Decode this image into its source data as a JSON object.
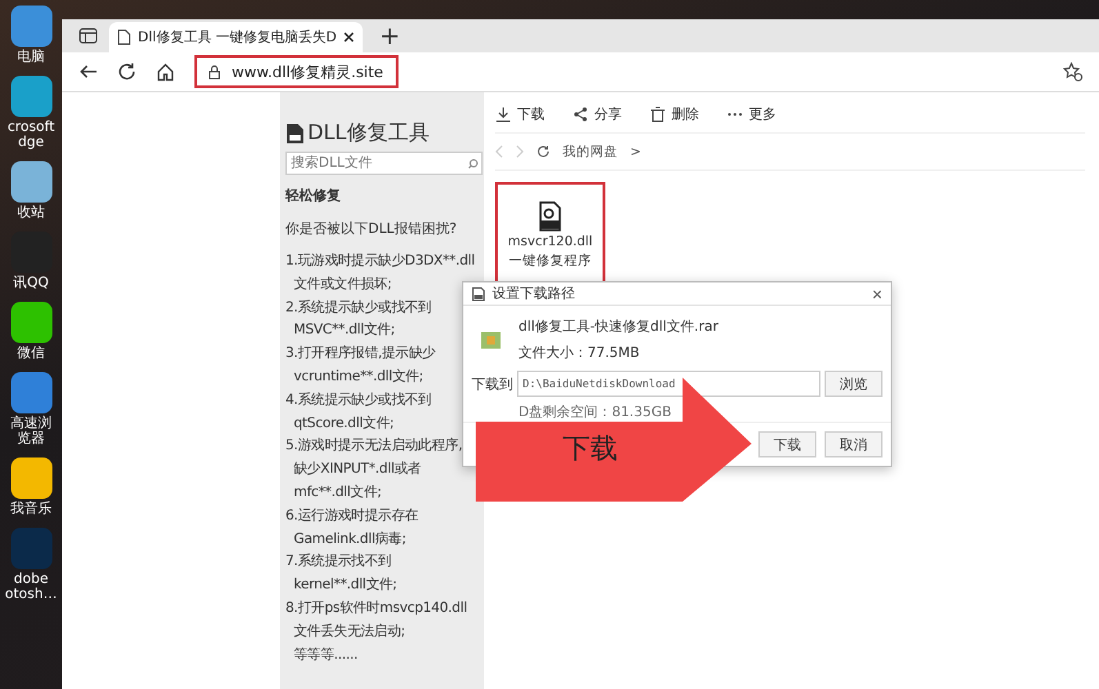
{
  "desktop_icons": [
    {
      "kind": "pc",
      "lines": [
        "电脑"
      ]
    },
    {
      "kind": "edge",
      "lines": [
        "crosoft",
        "dge"
      ]
    },
    {
      "kind": "bin",
      "lines": [
        "收站"
      ]
    },
    {
      "kind": "qq",
      "lines": [
        "讯QQ"
      ]
    },
    {
      "kind": "wechat",
      "lines": [
        "微信"
      ]
    },
    {
      "kind": "browser",
      "lines": [
        "高速浏",
        "览器"
      ]
    },
    {
      "kind": "music",
      "lines": [
        "我音乐"
      ]
    },
    {
      "kind": "ps",
      "lines": [
        "dobe",
        "otosh…"
      ]
    }
  ],
  "browser": {
    "tab": {
      "title": "Dll修复工具 一键修复电脑丢失D",
      "selected": true
    },
    "new_tab": "+",
    "address": "www.dll修复精灵.site"
  },
  "sidebar": {
    "title": "DLL修复工具",
    "search": {
      "placeholder": "搜索DLL文件"
    },
    "subtitle": "轻松修复",
    "question": "你是否被以下DLL报错困扰?",
    "items": [
      {
        "lines": [
          "1.玩游戏时提示缺少D3DX**.dll",
          "文件或文件损坏;"
        ]
      },
      {
        "lines": [
          "2.系统提示缺少或找不到",
          "MSVC**.dll文件;"
        ]
      },
      {
        "lines": [
          "3.打开程序报错,提示缺少",
          "vcruntime**.dll文件;"
        ]
      },
      {
        "lines": [
          "4.系统提示缺少或找不到",
          "qtScore.dll文件;"
        ]
      },
      {
        "lines": [
          "5.游戏时提示无法启动此程序,",
          "缺少XINPUT*.dll或者",
          "mfc**.dll文件;"
        ]
      },
      {
        "lines": [
          "6.运行游戏时提示存在",
          "Gamelink.dll病毒;"
        ]
      },
      {
        "lines": [
          "7.系统提示找不到",
          "kernel**.dll文件;"
        ]
      },
      {
        "lines": [
          "8.打开ps软件时msvcp140.dll",
          "文件丢失无法启动;",
          "等等等......"
        ]
      }
    ]
  },
  "toolbar": [
    {
      "kind": "download",
      "label": "下载"
    },
    {
      "kind": "share",
      "label": "分享"
    },
    {
      "kind": "delete",
      "label": "删除"
    },
    {
      "kind": "more",
      "label": "更多"
    }
  ],
  "breadcrumb": {
    "path": "我的网盘",
    "separator": ">"
  },
  "file": {
    "name": "msvcr120.dll",
    "subtitle": "一键修复程序"
  },
  "dialog": {
    "title": "设置下载路径",
    "close": "×",
    "file_name": "dll修复工具-快速修复dll文件.rar",
    "file_size": "文件大小：77.5MB",
    "path_label": "下载到",
    "path": "D:\\BaiduNetdiskDownload",
    "browse": "浏览",
    "free_space": "D盘剩余空间：81.35GB",
    "buttons": [
      "下载",
      "取消"
    ]
  },
  "arrow_label": "下载"
}
